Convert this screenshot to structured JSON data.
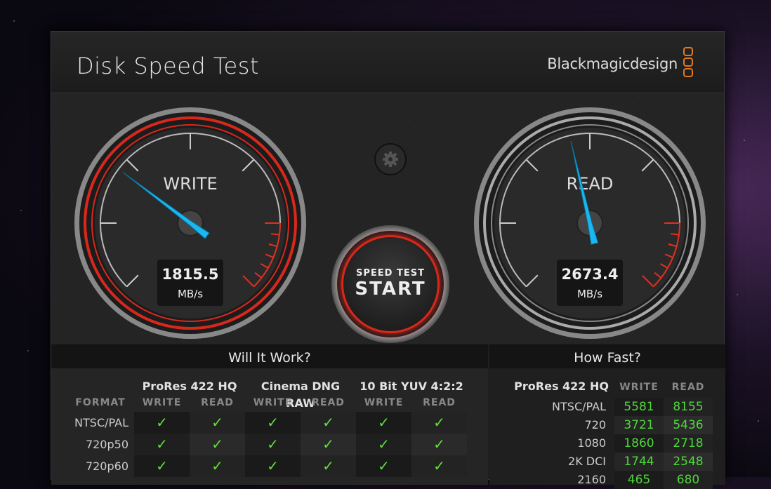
{
  "app": {
    "title": "Disk Speed Test",
    "brand": "Blackmagicdesign",
    "close_label": "×"
  },
  "colors": {
    "needle": "#1ab8f0",
    "ring_red": "#d8281c",
    "check": "#5ee03a",
    "value_green": "#4fd83a",
    "logo_orange": "#e07a20"
  },
  "gauges": {
    "write": {
      "label": "WRITE",
      "value": "1815.5",
      "unit": "MB/s"
    },
    "read": {
      "label": "READ",
      "value": "2673.4",
      "unit": "MB/s"
    }
  },
  "start_button": {
    "line1": "SPEED TEST",
    "line2": "START",
    "settings_icon": "gear-icon"
  },
  "will_it_work": {
    "title": "Will It Work?",
    "format_header": "FORMAT",
    "groups": [
      "ProRes 422 HQ",
      "Cinema DNG RAW",
      "10 Bit YUV 4:2:2"
    ],
    "sub_headers": [
      "WRITE",
      "READ",
      "WRITE",
      "READ",
      "WRITE",
      "READ"
    ],
    "rows": [
      {
        "format": "NTSC/PAL",
        "checks": [
          "✓",
          "✓",
          "✓",
          "✓",
          "✓",
          "✓"
        ]
      },
      {
        "format": "720p50",
        "checks": [
          "✓",
          "✓",
          "✓",
          "✓",
          "✓",
          "✓"
        ]
      },
      {
        "format": "720p60",
        "checks": [
          "✓",
          "✓",
          "✓",
          "✓",
          "✓",
          "✓"
        ]
      }
    ]
  },
  "how_fast": {
    "title": "How Fast?",
    "codec": "ProRes 422 HQ",
    "headers": [
      "WRITE",
      "READ"
    ],
    "rows": [
      {
        "format": "NTSC/PAL",
        "write": "5581",
        "read": "8155"
      },
      {
        "format": "720",
        "write": "3721",
        "read": "5436"
      },
      {
        "format": "1080",
        "write": "1860",
        "read": "2718"
      },
      {
        "format": "2K DCI",
        "write": "1744",
        "read": "2548"
      },
      {
        "format": "2160",
        "write": "465",
        "read": "680"
      }
    ]
  }
}
